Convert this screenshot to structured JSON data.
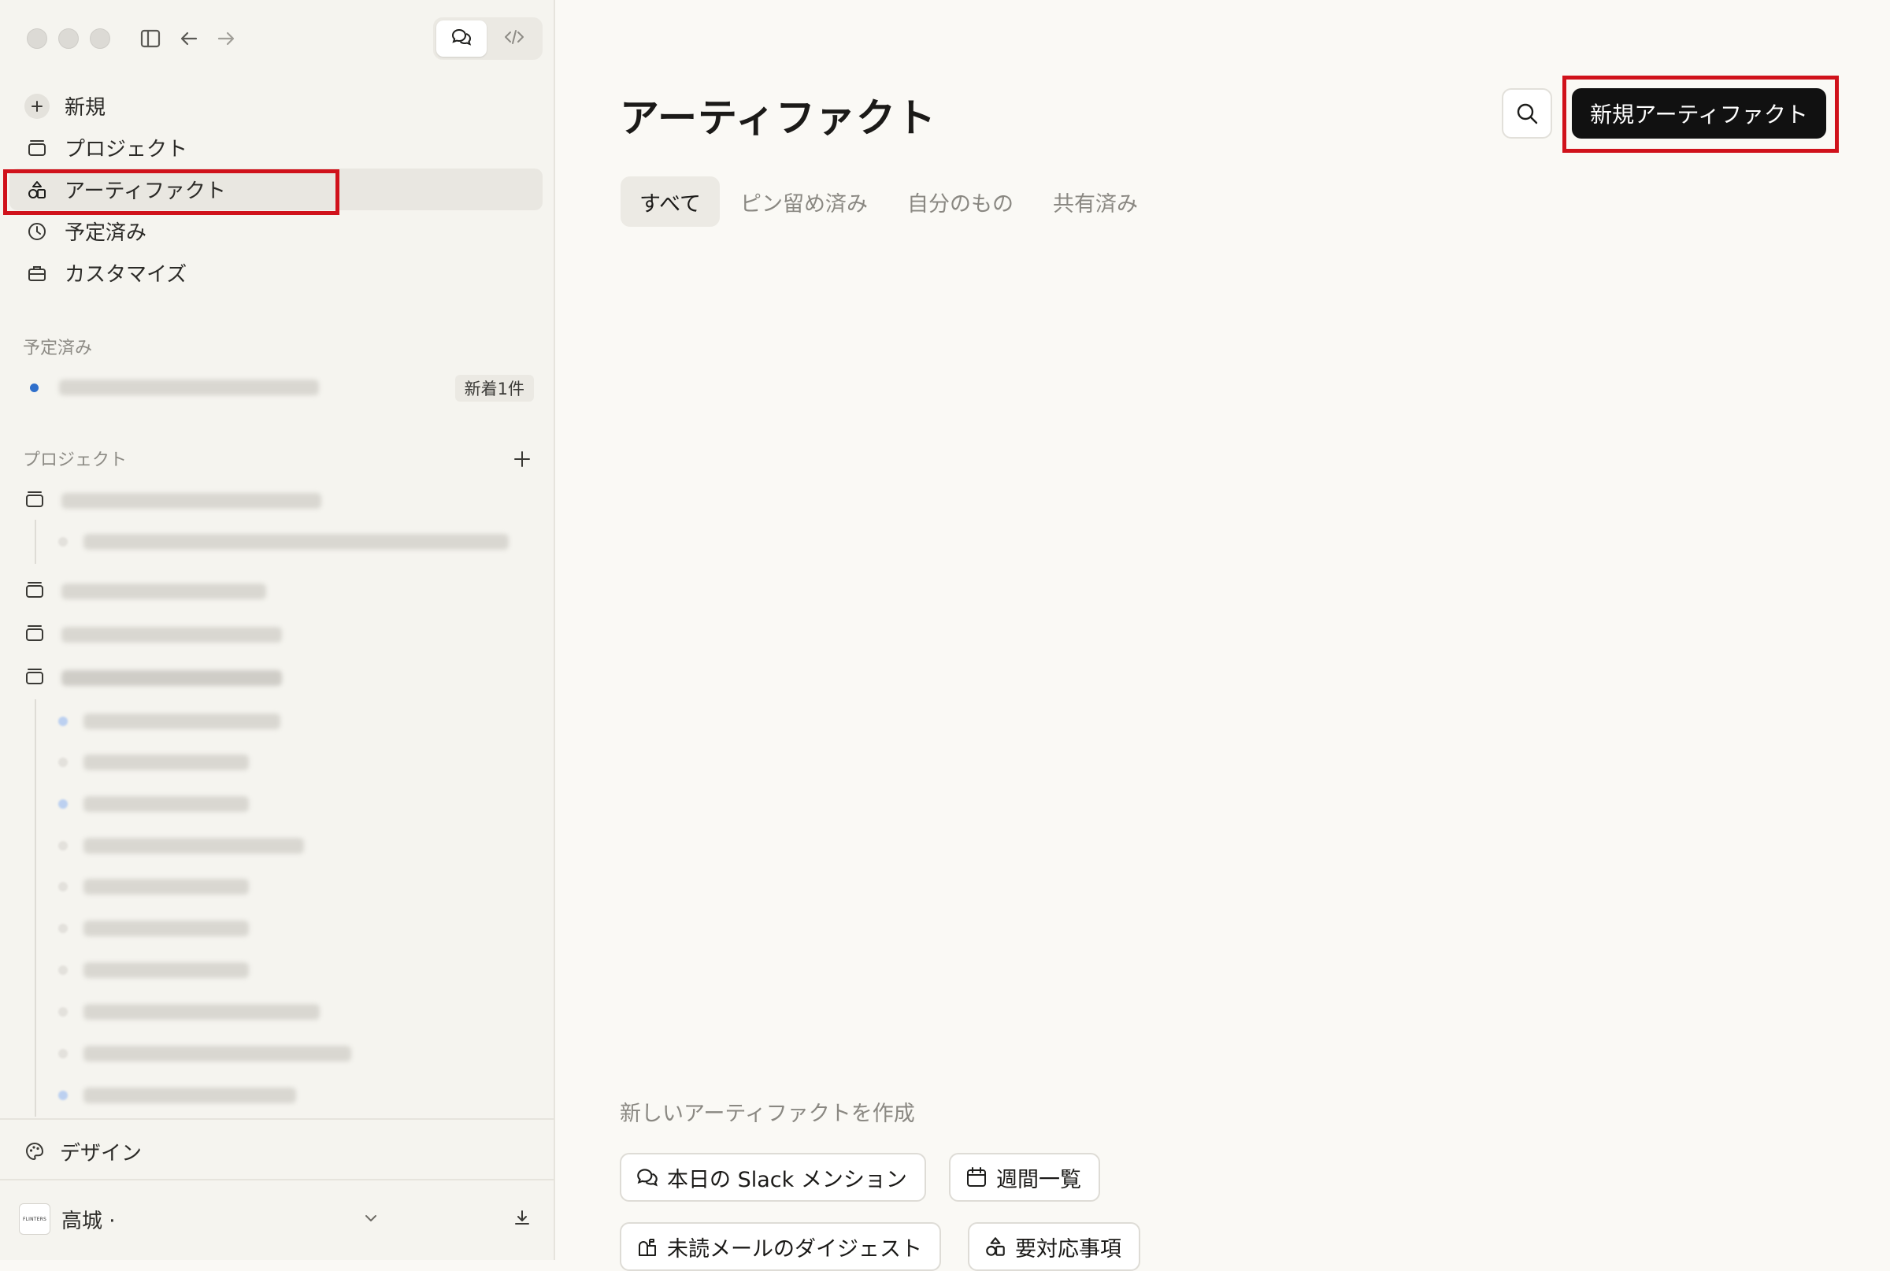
{
  "sidebar": {
    "nav": [
      {
        "label": "新規",
        "icon": "plus-icon"
      },
      {
        "label": "プロジェクト",
        "icon": "folder-icon"
      },
      {
        "label": "アーティファクト",
        "icon": "artifacts-icon"
      },
      {
        "label": "予定済み",
        "icon": "clock-icon"
      },
      {
        "label": "カスタマイズ",
        "icon": "briefcase-icon"
      }
    ],
    "scheduled_section_label": "予定済み",
    "scheduled_badge": "新着1件",
    "projects_section_label": "プロジェクト",
    "design_label": "デザイン",
    "user_name": "高城 ·",
    "avatar_text": "FLINTERS"
  },
  "main": {
    "title": "アーティファクト",
    "new_artifact_button": "新規アーティファクト",
    "tabs": [
      "すべて",
      "ピン留め済み",
      "自分のもの",
      "共有済み"
    ],
    "create_label": "新しいアーティファクトを作成",
    "suggestions": [
      "本日の Slack メンション",
      "週間一覧",
      "未読メールのダイジェスト",
      "要対応事項"
    ]
  },
  "colors": {
    "highlight": "#d0121b",
    "primary_button": "#111111",
    "sidebar_bg": "#f5f4ef",
    "main_bg": "#faf9f5",
    "dot_blue": "#2f6fcb"
  }
}
